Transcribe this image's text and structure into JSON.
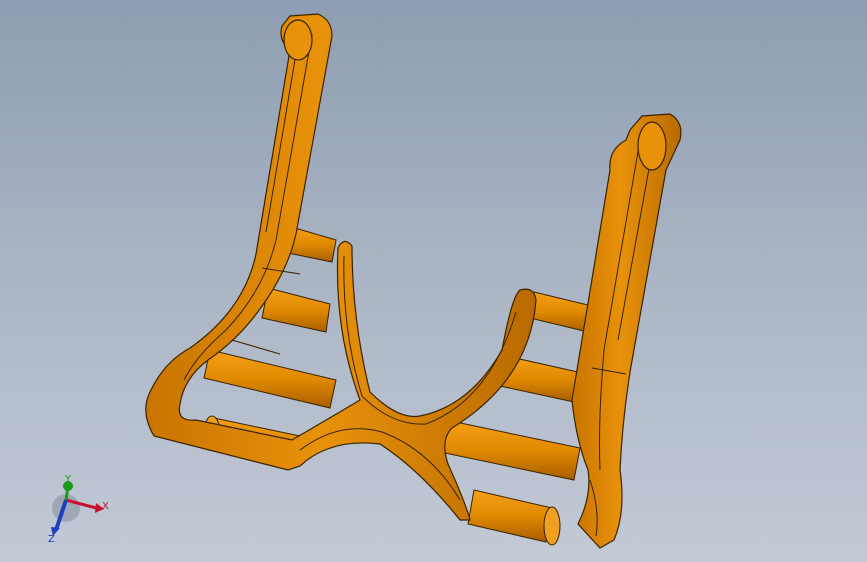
{
  "viewport": {
    "background_top": "#8e9db1",
    "background_bottom": "#c3cad6"
  },
  "model": {
    "part_color": "#e08a00",
    "part_shadow_color": "#b86a00",
    "edge_color": "#3a2200"
  },
  "triad": {
    "x_label": "X",
    "y_label": "Y",
    "z_label": "Z",
    "x_color": "#c8102e",
    "y_color": "#1a9a1a",
    "z_color": "#1f3fbf"
  }
}
